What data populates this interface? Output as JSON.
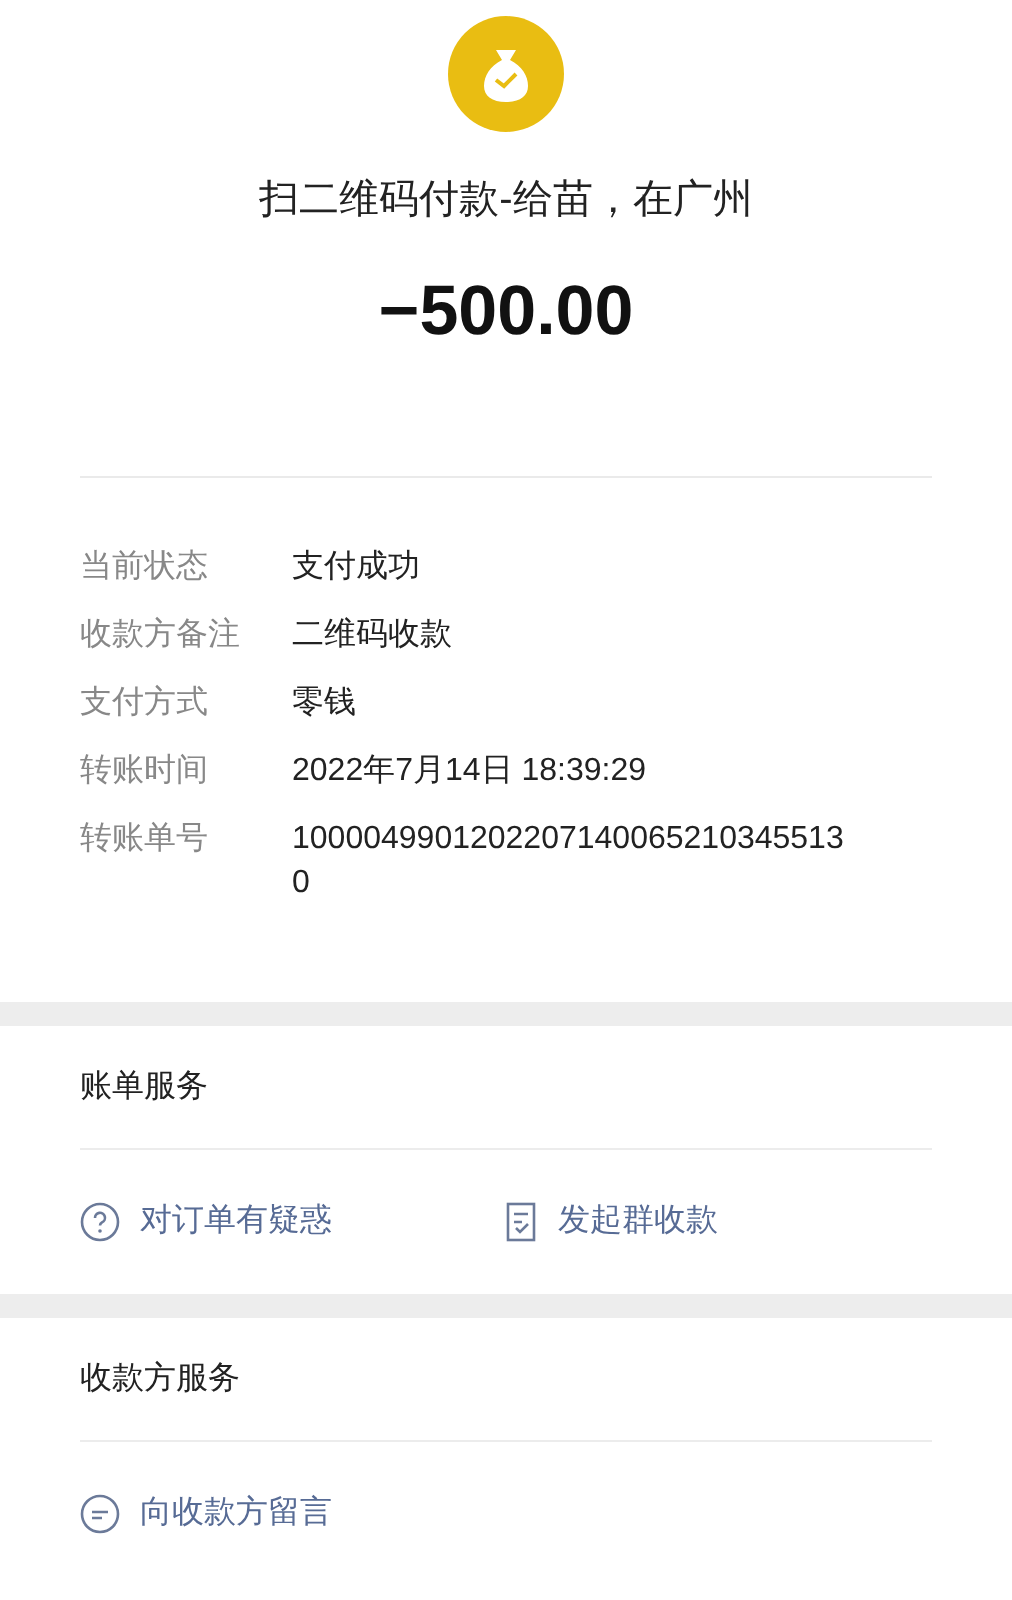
{
  "header": {
    "title": "扫二维码付款-给苗，在广州",
    "amount": "−500.00"
  },
  "details": [
    {
      "label": "当前状态",
      "value": "支付成功"
    },
    {
      "label": "收款方备注",
      "value": "二维码收款"
    },
    {
      "label": "支付方式",
      "value": "零钱"
    },
    {
      "label": "转账时间",
      "value": "2022年7月14日 18:39:29"
    },
    {
      "label": "转账单号",
      "value": "10000499012022071400652103455130"
    }
  ],
  "sections": [
    {
      "title": "账单服务",
      "actions": [
        {
          "kind": "question",
          "label": "对订单有疑惑"
        },
        {
          "kind": "bill",
          "label": "发起群收款"
        }
      ]
    },
    {
      "title": "收款方服务",
      "actions": [
        {
          "kind": "message",
          "label": "向收款方留言"
        }
      ]
    }
  ]
}
